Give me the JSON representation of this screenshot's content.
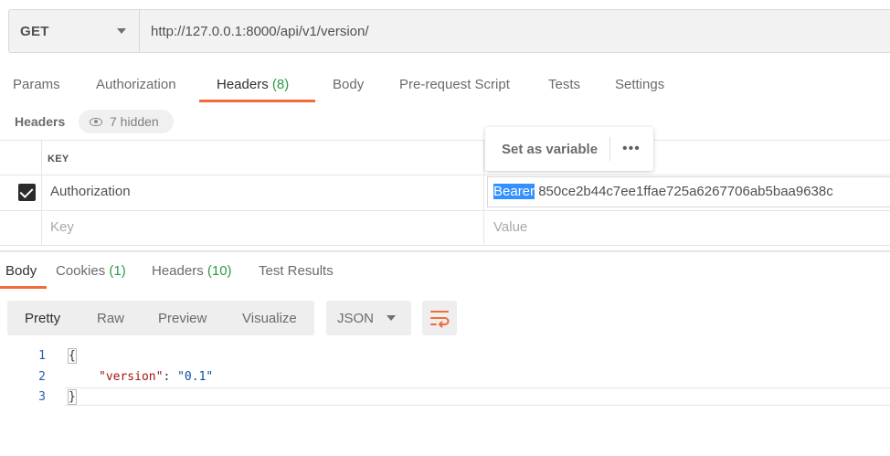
{
  "request": {
    "method": "GET",
    "url": "http://127.0.0.1:8000/api/v1/version/"
  },
  "request_tabs": [
    {
      "label": "Params",
      "count": ""
    },
    {
      "label": "Authorization",
      "count": ""
    },
    {
      "label": "Headers",
      "count": "(8)"
    },
    {
      "label": "Body",
      "count": ""
    },
    {
      "label": "Pre-request Script",
      "count": ""
    },
    {
      "label": "Tests",
      "count": ""
    },
    {
      "label": "Settings",
      "count": ""
    }
  ],
  "headers_section": {
    "title": "Headers",
    "hidden": "7 hidden",
    "column_key": "KEY",
    "rows": [
      {
        "checked": true,
        "key": "Authorization",
        "value_selected": "Bearer",
        "value_rest": " 850ce2b44c7ee1ffae725a6267706ab5baa9638c"
      }
    ],
    "placeholder_key": "Key",
    "placeholder_value": "Value"
  },
  "tooltip": {
    "label": "Set as variable",
    "more": "•••"
  },
  "response_tabs": [
    {
      "label": "Body",
      "count": ""
    },
    {
      "label": "Cookies",
      "count": "(1)"
    },
    {
      "label": "Headers",
      "count": "(10)"
    },
    {
      "label": "Test Results",
      "count": ""
    }
  ],
  "response_toolbar": {
    "views": [
      "Pretty",
      "Raw",
      "Preview",
      "Visualize"
    ],
    "format": "JSON"
  },
  "code": {
    "line_numbers": [
      "1",
      "2",
      "3"
    ],
    "open": "{",
    "key": "\"version\"",
    "colon": ": ",
    "value": "\"0.1\"",
    "close": "}"
  },
  "colors": {
    "accent": "#f26b3a",
    "count_green": "#2c9b45",
    "selection": "#3391ff"
  }
}
